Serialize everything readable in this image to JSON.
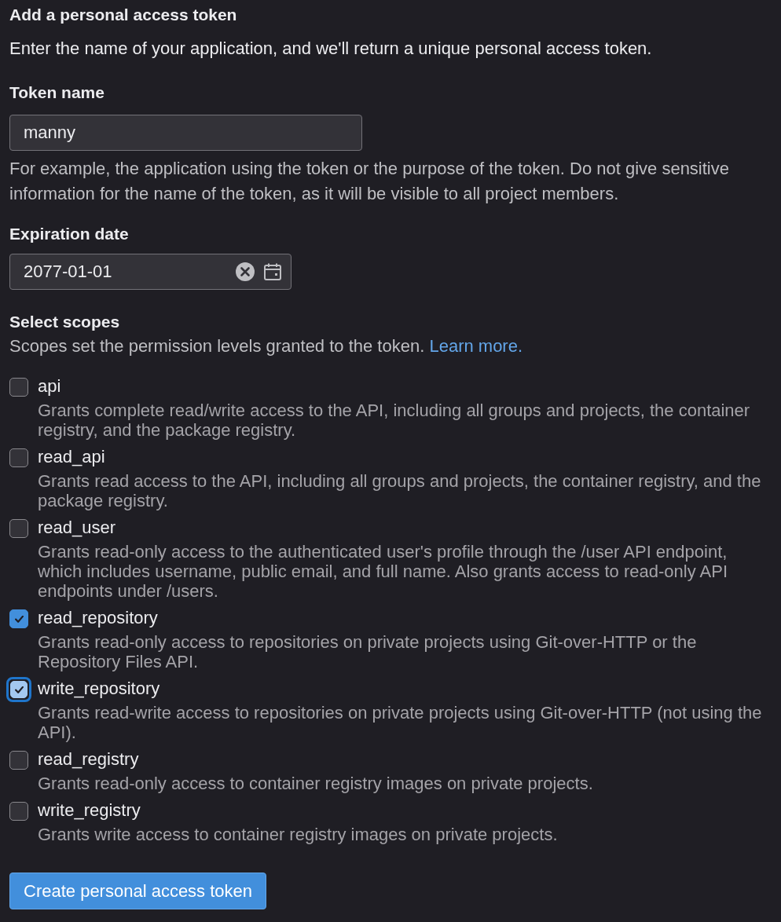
{
  "title": "Add a personal access token",
  "intro": "Enter the name of your application, and we'll return a unique personal access token.",
  "token_name": {
    "label": "Token name",
    "value": "manny",
    "help": "For example, the application using the token or the purpose of the token. Do not give sensitive information for the name of the token, as it will be visible to all project members."
  },
  "expiration_date": {
    "label": "Expiration date",
    "value": "2077-01-01"
  },
  "scopes": {
    "label": "Select scopes",
    "description": "Scopes set the permission levels granted to the token.",
    "link": "Learn more.",
    "items": [
      {
        "name": "api",
        "description": "Grants complete read/write access to the API, including all groups and projects, the container registry, and the package registry.",
        "checked": false,
        "focused": false
      },
      {
        "name": "read_api",
        "description": "Grants read access to the API, including all groups and projects, the container registry, and the package registry.",
        "checked": false,
        "focused": false
      },
      {
        "name": "read_user",
        "description": "Grants read-only access to the authenticated user's profile through the /user API endpoint, which includes username, public email, and full name. Also grants access to read-only API endpoints under /users.",
        "checked": false,
        "focused": false
      },
      {
        "name": "read_repository",
        "description": "Grants read-only access to repositories on private projects using Git-over-HTTP or the Repository Files API.",
        "checked": true,
        "focused": false
      },
      {
        "name": "write_repository",
        "description": "Grants read-write access to repositories on private projects using Git-over-HTTP (not using the API).",
        "checked": true,
        "focused": true
      },
      {
        "name": "read_registry",
        "description": "Grants read-only access to container registry images on private projects.",
        "checked": false,
        "focused": false
      },
      {
        "name": "write_registry",
        "description": "Grants write access to container registry images on private projects.",
        "checked": false,
        "focused": false
      }
    ]
  },
  "submit_button": "Create personal access token"
}
